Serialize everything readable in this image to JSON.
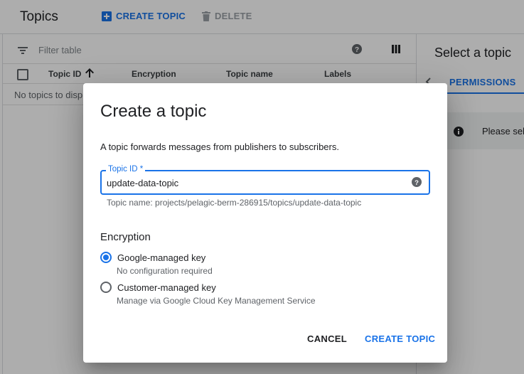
{
  "header": {
    "title": "Topics",
    "create_label": "CREATE TOPIC",
    "delete_label": "DELETE"
  },
  "filter": {
    "placeholder": "Filter table"
  },
  "table": {
    "columns": [
      "Topic ID",
      "Encryption",
      "Topic name",
      "Labels"
    ],
    "empty_text": "No topics to display"
  },
  "side_panel": {
    "title": "Select a topic",
    "tab": "PERMISSIONS",
    "info_text": "Please select"
  },
  "dialog": {
    "title": "Create a topic",
    "description": "A topic forwards messages from publishers to subscribers.",
    "topic_id_label": "Topic ID *",
    "topic_id_value": "update-data-topic",
    "topic_name_hint": "Topic name: projects/pelagic-berm-286915/topics/update-data-topic",
    "encryption_title": "Encryption",
    "options": [
      {
        "label": "Google-managed key",
        "sub": "No configuration required",
        "selected": true
      },
      {
        "label": "Customer-managed key",
        "sub": "Manage via Google Cloud Key Management Service",
        "selected": false
      }
    ],
    "cancel_label": "CANCEL",
    "create_label": "CREATE TOPIC"
  },
  "colors": {
    "accent": "#1a73e8",
    "scrim": "rgba(0,0,0,0.32)"
  },
  "icons": [
    "add-box-icon",
    "trash-icon",
    "filter-icon",
    "help-icon",
    "columns-icon",
    "sort-arrow-up-icon",
    "chevron-left-icon",
    "info-icon"
  ]
}
